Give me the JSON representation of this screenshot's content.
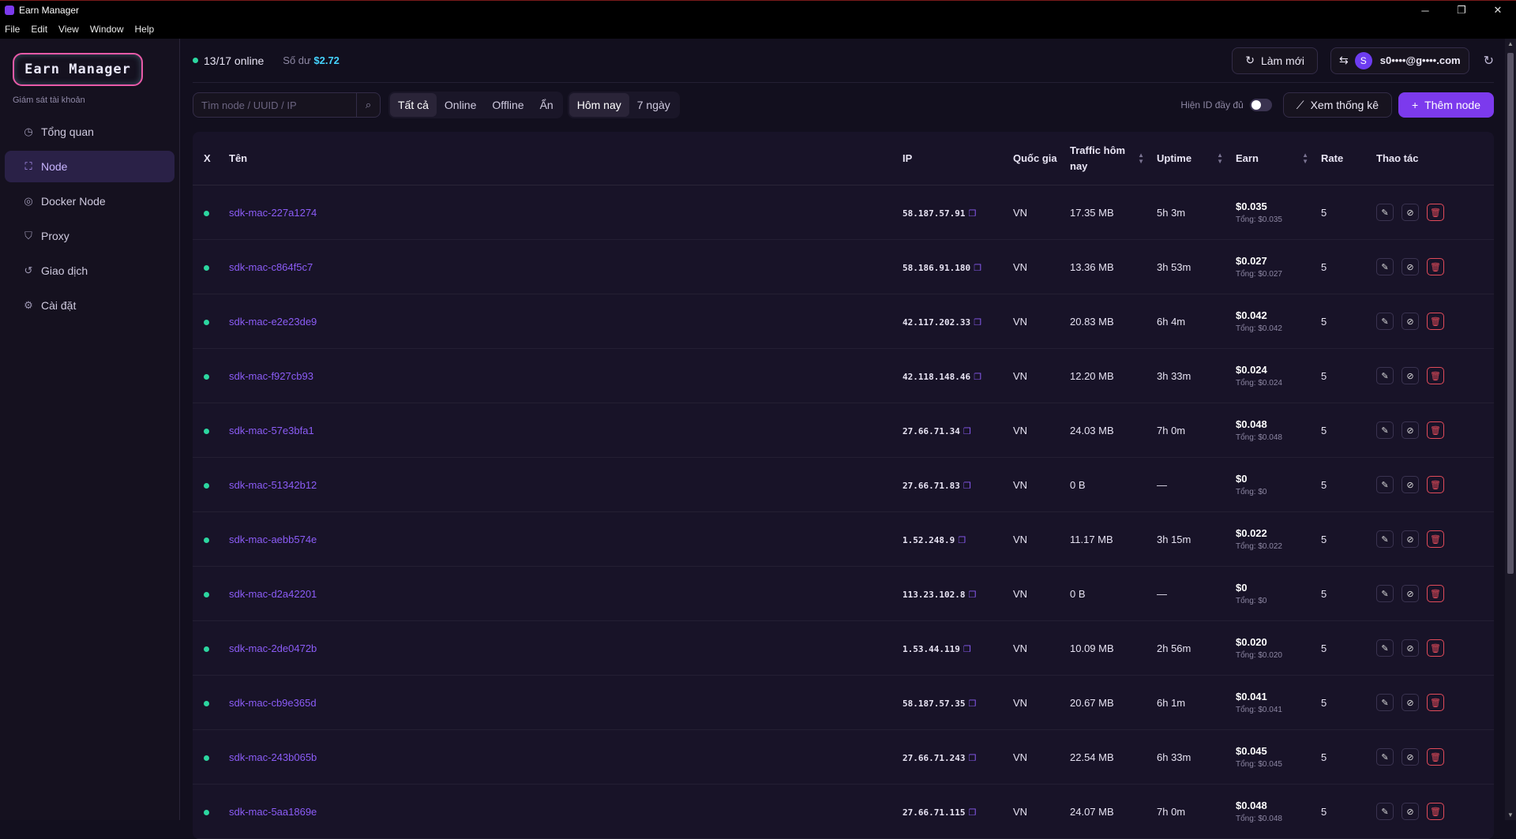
{
  "window": {
    "title": "Earn Manager",
    "controls": [
      "─",
      "❐",
      "✕"
    ]
  },
  "menu": [
    "File",
    "Edit",
    "View",
    "Window",
    "Help"
  ],
  "sidebar": {
    "logo": "Earn Manager",
    "subtitle": "Giám sát tài khoản",
    "items": [
      {
        "label": "Tổng quan",
        "icon": "dashboard-icon"
      },
      {
        "label": "Node",
        "icon": "node-icon"
      },
      {
        "label": "Docker Node",
        "icon": "docker-icon"
      },
      {
        "label": "Proxy",
        "icon": "shield-icon"
      },
      {
        "label": "Giao dịch",
        "icon": "history-icon"
      },
      {
        "label": "Cài đặt",
        "icon": "gear-icon"
      }
    ]
  },
  "header": {
    "online": "13/17 online",
    "balance_label": "Số dư",
    "balance": "$2.72",
    "refresh": "Làm mới",
    "account": "s0••••@g••••.com",
    "avatar": "S"
  },
  "filters": {
    "search_placeholder": "Tìm node / UUID / IP",
    "status": [
      "Tất cả",
      "Online",
      "Offline",
      "Ẩn"
    ],
    "range": [
      "Hôm nay",
      "7 ngày"
    ],
    "show_id": "Hiện ID đầy đủ",
    "stats": "Xem thống kê",
    "add": "Thêm node"
  },
  "table": {
    "headers": {
      "x": "X",
      "name": "Tên",
      "ip": "IP",
      "country": "Quốc gia",
      "traffic": "Traffic hôm nay",
      "uptime": "Uptime",
      "earn": "Earn",
      "rate": "Rate",
      "actions": "Thao tác"
    },
    "rows": [
      {
        "name": "sdk-mac-227a1274",
        "ip": "58.187.57.91",
        "country": "VN",
        "traffic": "17.35 MB",
        "uptime": "5h 3m",
        "earn": "$0.035",
        "total": "Tổng: $0.035",
        "rate": "5"
      },
      {
        "name": "sdk-mac-c864f5c7",
        "ip": "58.186.91.180",
        "country": "VN",
        "traffic": "13.36 MB",
        "uptime": "3h 53m",
        "earn": "$0.027",
        "total": "Tổng: $0.027",
        "rate": "5"
      },
      {
        "name": "sdk-mac-e2e23de9",
        "ip": "42.117.202.33",
        "country": "VN",
        "traffic": "20.83 MB",
        "uptime": "6h 4m",
        "earn": "$0.042",
        "total": "Tổng: $0.042",
        "rate": "5"
      },
      {
        "name": "sdk-mac-f927cb93",
        "ip": "42.118.148.46",
        "country": "VN",
        "traffic": "12.20 MB",
        "uptime": "3h 33m",
        "earn": "$0.024",
        "total": "Tổng: $0.024",
        "rate": "5"
      },
      {
        "name": "sdk-mac-57e3bfa1",
        "ip": "27.66.71.34",
        "country": "VN",
        "traffic": "24.03 MB",
        "uptime": "7h 0m",
        "earn": "$0.048",
        "total": "Tổng: $0.048",
        "rate": "5"
      },
      {
        "name": "sdk-mac-51342b12",
        "ip": "27.66.71.83",
        "country": "VN",
        "traffic": "0 B",
        "uptime": "—",
        "earn": "$0",
        "total": "Tổng: $0",
        "rate": "5"
      },
      {
        "name": "sdk-mac-aebb574e",
        "ip": "1.52.248.9",
        "country": "VN",
        "traffic": "11.17 MB",
        "uptime": "3h 15m",
        "earn": "$0.022",
        "total": "Tổng: $0.022",
        "rate": "5"
      },
      {
        "name": "sdk-mac-d2a42201",
        "ip": "113.23.102.8",
        "country": "VN",
        "traffic": "0 B",
        "uptime": "—",
        "earn": "$0",
        "total": "Tổng: $0",
        "rate": "5"
      },
      {
        "name": "sdk-mac-2de0472b",
        "ip": "1.53.44.119",
        "country": "VN",
        "traffic": "10.09 MB",
        "uptime": "2h 56m",
        "earn": "$0.020",
        "total": "Tổng: $0.020",
        "rate": "5"
      },
      {
        "name": "sdk-mac-cb9e365d",
        "ip": "58.187.57.35",
        "country": "VN",
        "traffic": "20.67 MB",
        "uptime": "6h 1m",
        "earn": "$0.041",
        "total": "Tổng: $0.041",
        "rate": "5"
      },
      {
        "name": "sdk-mac-243b065b",
        "ip": "27.66.71.243",
        "country": "VN",
        "traffic": "22.54 MB",
        "uptime": "6h 33m",
        "earn": "$0.045",
        "total": "Tổng: $0.045",
        "rate": "5"
      },
      {
        "name": "sdk-mac-5aa1869e",
        "ip": "27.66.71.115",
        "country": "VN",
        "traffic": "24.07 MB",
        "uptime": "7h 0m",
        "earn": "$0.048",
        "total": "Tổng: $0.048",
        "rate": "5"
      }
    ]
  }
}
